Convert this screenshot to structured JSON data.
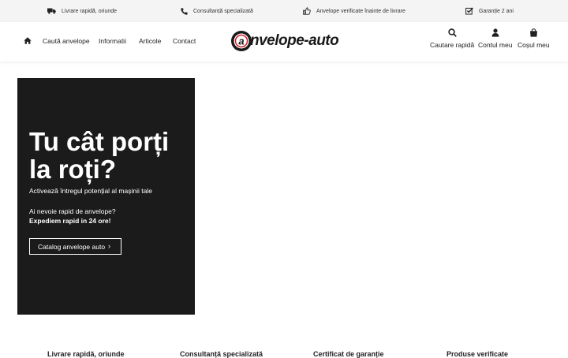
{
  "topbar": {
    "items": [
      {
        "icon": "truck-icon",
        "text": "Livrare rapidă, oriunde"
      },
      {
        "icon": "phone-icon",
        "text": "Consultanță specializată"
      },
      {
        "icon": "thumbs-up-icon",
        "text": "Anvelope verificate înainte de livrare"
      },
      {
        "icon": "checkbox-icon",
        "text": "Garanție 2 ani"
      }
    ]
  },
  "nav": {
    "home_icon": "home-icon",
    "links": [
      "Caută anvelope",
      "Informatii",
      "Articole",
      "Contact"
    ]
  },
  "logo": {
    "text": "nvelope-auto"
  },
  "actions": [
    {
      "icon": "search-icon",
      "label": "Cautare rapidă"
    },
    {
      "icon": "user-icon",
      "label": "Contul meu"
    },
    {
      "icon": "shopping-bag-icon",
      "label": "Coșul meu"
    }
  ],
  "hero": {
    "title": "Tu cât porți la roți?",
    "subtitle": "Activează întregul potențial al mașinii tale",
    "question": "Ai nevoie rapid de anvelope?",
    "strong": "Expediem rapid in 24 ore!",
    "button_label": "Catalog anvelope auto",
    "button_chevron": "›"
  },
  "features": [
    "Livrare rapidă, oriunde",
    "Consultanță specializată",
    "Certificat de garanție",
    "Produse verificate"
  ],
  "colors": {
    "hero_bg": "#1b1b1b",
    "topbar_bg": "#f4f4f4",
    "logo_red": "#d4202a"
  }
}
